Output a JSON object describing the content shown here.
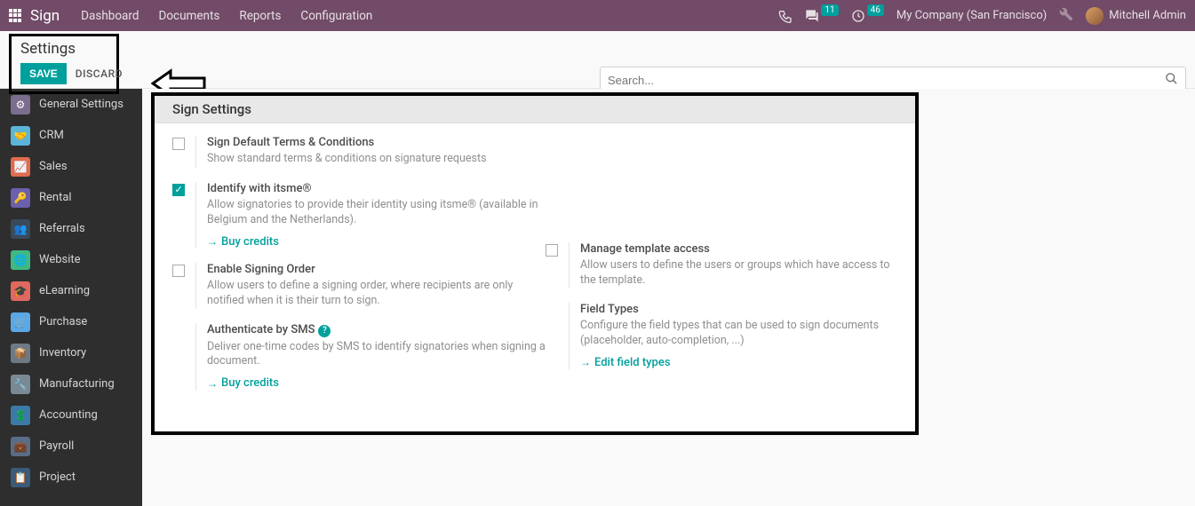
{
  "navbar": {
    "app_name": "Sign",
    "menu": [
      "Dashboard",
      "Documents",
      "Reports",
      "Configuration"
    ],
    "messages_badge": "11",
    "activities_badge": "46",
    "company": "My Company (San Francisco)",
    "user": "Mitchell Admin"
  },
  "header": {
    "title": "Settings",
    "save_label": "SAVE",
    "discard_label": "DISCARD",
    "search_placeholder": "Search..."
  },
  "sidebar": {
    "items": [
      {
        "label": "General Settings"
      },
      {
        "label": "CRM"
      },
      {
        "label": "Sales"
      },
      {
        "label": "Rental"
      },
      {
        "label": "Referrals"
      },
      {
        "label": "Website"
      },
      {
        "label": "eLearning"
      },
      {
        "label": "Purchase"
      },
      {
        "label": "Inventory"
      },
      {
        "label": "Manufacturing"
      },
      {
        "label": "Accounting"
      },
      {
        "label": "Payroll"
      },
      {
        "label": "Project"
      }
    ]
  },
  "panel": {
    "header": "Sign Settings",
    "left": [
      {
        "title": "Sign Default Terms & Conditions",
        "desc": "Show standard terms & conditions on signature requests",
        "checked": false
      },
      {
        "title": "Identify with itsme®",
        "desc": "Allow signatories to provide their identity using itsme® (available in Belgium and the Netherlands).",
        "link": "Buy credits",
        "checked": true
      },
      {
        "title": "Enable Signing Order",
        "desc": "Allow users to define a signing order, where recipients are only notified when it is their turn to sign.",
        "checked": false
      },
      {
        "title": "Authenticate by SMS",
        "desc": "Deliver one-time codes by SMS to identify signatories when signing a document.",
        "link": "Buy credits",
        "help": true
      }
    ],
    "right": [
      {
        "title": "Manage template access",
        "desc": "Allow users to define the users or groups which have access to the template.",
        "checked": false
      },
      {
        "title": "Field Types",
        "desc": "Configure the field types that can be used to sign documents (placeholder, auto-completion, ...)",
        "link": "Edit field types"
      }
    ]
  }
}
